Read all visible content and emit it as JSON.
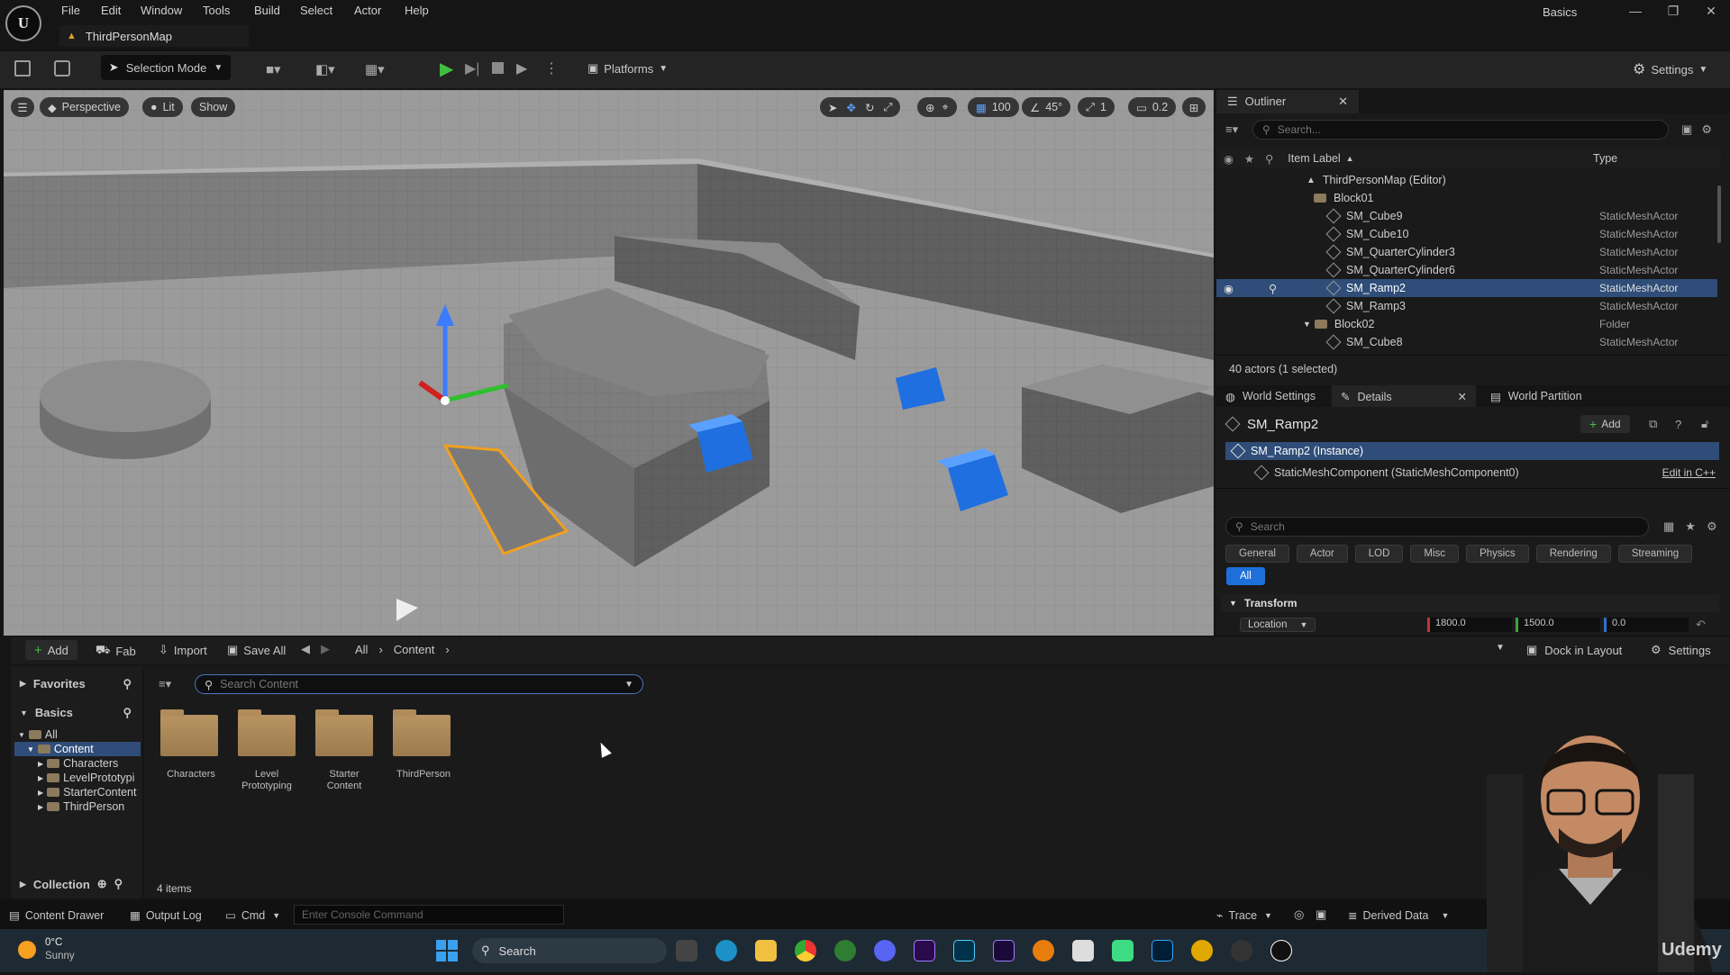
{
  "app": {
    "tab_title": "ThirdPersonMap",
    "project": "Basics"
  },
  "menu": [
    "File",
    "Edit",
    "Window",
    "Tools",
    "Build",
    "Select",
    "Actor",
    "Help"
  ],
  "toolbar": {
    "mode": "Selection Mode",
    "platforms": "Platforms",
    "settings": "Settings"
  },
  "viewport": {
    "perspective": "Perspective",
    "lit": "Lit",
    "show": "Show",
    "grid_snap": "100",
    "rot_snap": "45°",
    "scale_snap": "1",
    "cam_speed": "0.2"
  },
  "outliner": {
    "title": "Outliner",
    "search_placeholder": "Search...",
    "col_label": "Item Label",
    "col_type": "Type",
    "rows": [
      {
        "label": "ThirdPersonMap (Editor)",
        "type": ""
      },
      {
        "label": "Block01",
        "type": ""
      },
      {
        "label": "SM_Cube9",
        "type": "StaticMeshActor"
      },
      {
        "label": "SM_Cube10",
        "type": "StaticMeshActor"
      },
      {
        "label": "SM_QuarterCylinder3",
        "type": "StaticMeshActor"
      },
      {
        "label": "SM_QuarterCylinder6",
        "type": "StaticMeshActor"
      },
      {
        "label": "SM_Ramp2",
        "type": "StaticMeshActor"
      },
      {
        "label": "SM_Ramp3",
        "type": "StaticMeshActor"
      },
      {
        "label": "Block02",
        "type": "Folder"
      },
      {
        "label": "SM_Cube8",
        "type": "StaticMeshActor"
      }
    ],
    "count": "40 actors (1 selected)"
  },
  "details": {
    "tab_world_settings": "World Settings",
    "tab_details": "Details",
    "tab_world_partition": "World Partition",
    "actor_name": "SM_Ramp2",
    "add": "Add",
    "instance": "SM_Ramp2 (Instance)",
    "component": "StaticMeshComponent (StaticMeshComponent0)",
    "edit_cpp": "Edit in C++",
    "search_placeholder": "Search",
    "categories": [
      "General",
      "Actor",
      "LOD",
      "Misc",
      "Physics",
      "Rendering",
      "Streaming"
    ],
    "all": "All",
    "section": "Transform",
    "location_label": "Location",
    "loc_x": "1800.0",
    "loc_y": "1500.0",
    "loc_z": "0.0"
  },
  "content_browser": {
    "add": "Add",
    "fab": "Fab",
    "import": "Import",
    "save_all": "Save All",
    "path_all": "All",
    "path_content": "Content",
    "dock": "Dock in Layout",
    "settings": "Settings",
    "favorites": "Favorites",
    "basics": "Basics",
    "search_placeholder": "Search Content",
    "tree": [
      "All",
      "Content",
      "Characters",
      "LevelPrototypi",
      "StarterContent",
      "ThirdPerson"
    ],
    "folders": [
      "Characters",
      "Level Prototyping",
      "Starter Content",
      "ThirdPerson"
    ],
    "collection": "Collection",
    "item_count": "4 items"
  },
  "statusbar": {
    "content_drawer": "Content Drawer",
    "output_log": "Output Log",
    "cmd": "Cmd",
    "console_placeholder": "Enter Console Command",
    "trace": "Trace",
    "derived_data": "Derived Data"
  },
  "taskbar": {
    "temp": "0°C",
    "weather": "Sunny",
    "search": "Search",
    "watermark": "Udemy"
  }
}
